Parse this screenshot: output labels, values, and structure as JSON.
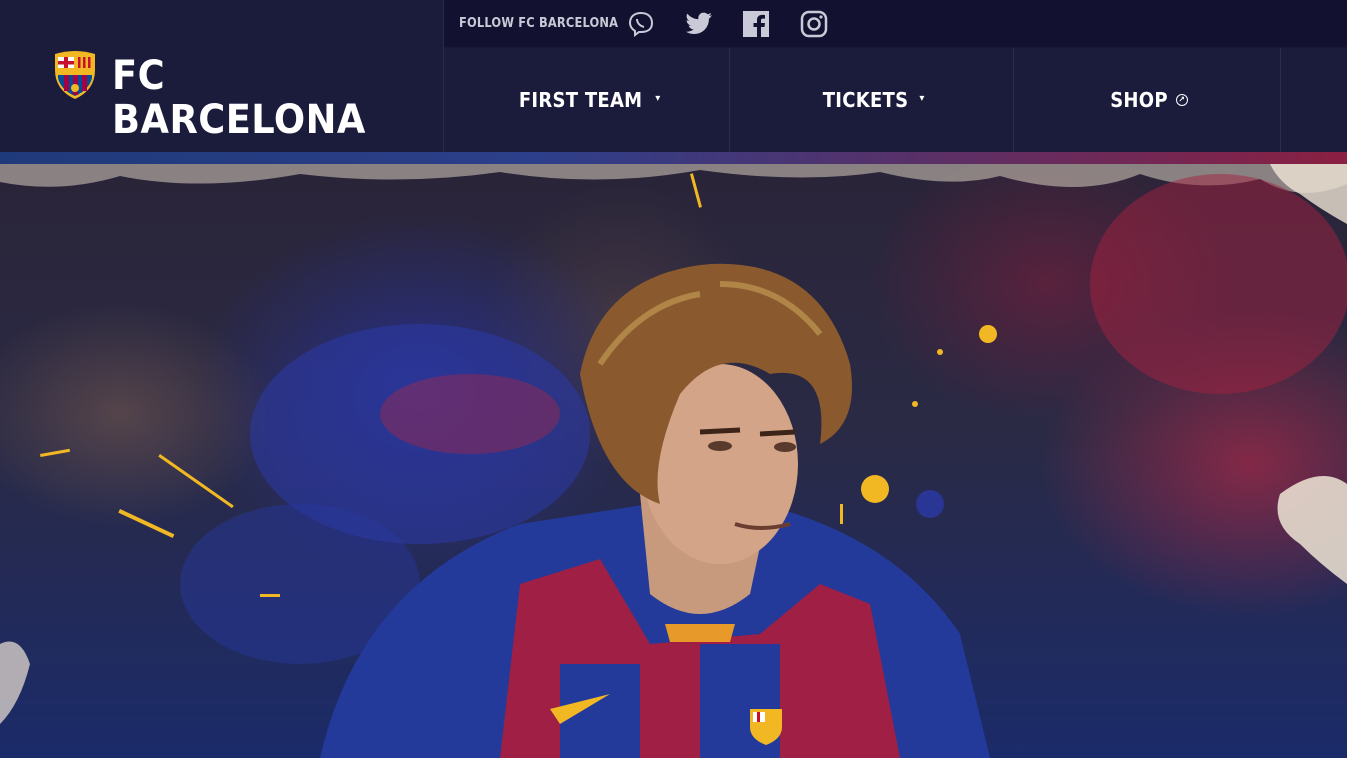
{
  "header": {
    "brand": "FC BARCELONA",
    "follow_label": "FOLLOW FC BARCELONA",
    "social_icons": [
      "viber-icon",
      "twitter-icon",
      "facebook-icon",
      "instagram-icon"
    ]
  },
  "nav": {
    "items": [
      {
        "label": "FIRST TEAM",
        "marker": "▾"
      },
      {
        "label": "TICKETS",
        "marker": "▾"
      },
      {
        "label": "SHOP",
        "marker": "↗"
      }
    ]
  },
  "colors": {
    "header_bg": "#1b1b3c",
    "social_bar_bg": "#121230",
    "accent_blue": "#2d3f8a",
    "accent_red": "#8a2042",
    "splash_gold": "#f2b824"
  }
}
